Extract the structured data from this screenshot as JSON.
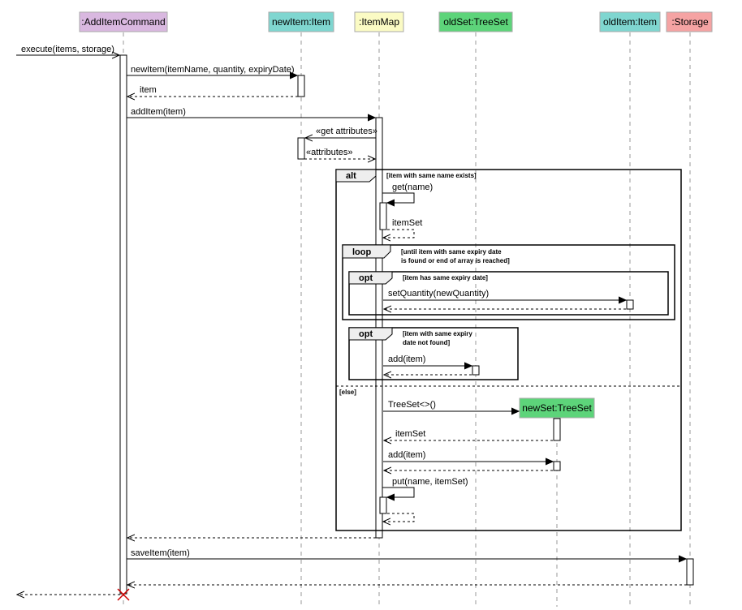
{
  "participants": [
    {
      "id": "addcmd",
      "label": ":AddItemCommand",
      "color": "#d9b8e0"
    },
    {
      "id": "newitem",
      "label": "newItem:Item",
      "color": "#7fd6d0"
    },
    {
      "id": "itemmap",
      "label": ":ItemMap",
      "color": "#fbfbc4"
    },
    {
      "id": "oldset",
      "label": "oldSet:TreeSet",
      "color": "#5dd47a"
    },
    {
      "id": "olditem",
      "label": "oldItem:Item",
      "color": "#7fd6d0"
    },
    {
      "id": "storage",
      "label": ":Storage",
      "color": "#f5a3a3"
    }
  ],
  "created_participant": {
    "label": "newSet:TreeSet",
    "color": "#5dd47a"
  },
  "messages": {
    "execute": "execute(items, storage)",
    "new_item": "newItem(itemName, quantity, expiryDate)",
    "item_return": "item",
    "add_item": "addItem(item)",
    "get_attributes": "«get attributes»",
    "attributes": "«attributes»",
    "get_name": "get(name)",
    "item_set_return": "itemSet",
    "set_quantity": "setQuantity(newQuantity)",
    "add_item_old": "add(item)",
    "treeset_create": "TreeSet<>()",
    "item_set_return2": "itemSet",
    "add_item_new": "add(item)",
    "put": "put(name, itemSet)",
    "save_item": "saveItem(item)"
  },
  "fragments": {
    "alt": {
      "keyword": "alt",
      "guard": "[item with same name exists]",
      "else_guard": "[else]"
    },
    "loop": {
      "keyword": "loop",
      "guard_line1": "[until item with same expiry date",
      "guard_line2": "is found or end of array is reached]"
    },
    "opt_inner": {
      "keyword": "opt",
      "guard": "[item has same expiry date]"
    },
    "opt_outer": {
      "keyword": "opt",
      "guard_line1": "[item with same expiry",
      "guard_line2": "date not found]"
    }
  }
}
